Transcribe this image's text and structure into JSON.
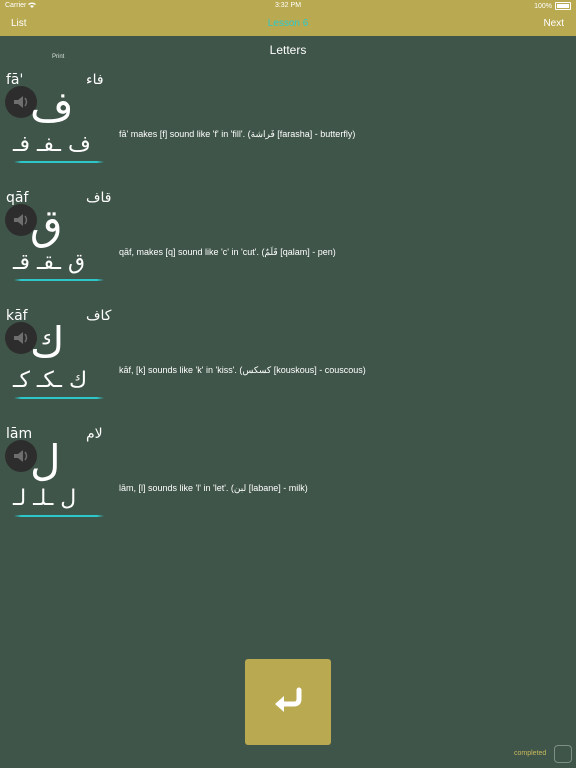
{
  "status_bar": {
    "carrier": "Carrier",
    "time": "3:32 PM",
    "battery": "100%"
  },
  "nav": {
    "left": "List",
    "title": "Lesson 6",
    "right": "Next"
  },
  "section_title": "Letters",
  "print_label": "Print",
  "letters": [
    {
      "latin_name": "fā'",
      "arabic_name": "فاء",
      "glyph": "ف",
      "forms": "ف ـفـ فـ",
      "description": "fā' makes [f] sound like 'f' in 'fill'. (فَراشة [farasha] - butterfly)"
    },
    {
      "latin_name": "qāf",
      "arabic_name": "قاف",
      "glyph": "ق",
      "forms": "ق ـقـ قـ",
      "description": "qāf, makes [q] sound like 'c' in 'cut'. (قَلَمٌ [qalam] - pen)"
    },
    {
      "latin_name": "kāf",
      "arabic_name": "كاف",
      "glyph": "ك",
      "forms": "ك ـكـ كـ",
      "description": "kāf, [k] sounds like 'k' in 'kiss'. (كسكس [kouskous] - couscous)"
    },
    {
      "latin_name": "lām",
      "arabic_name": "لام",
      "glyph": "ل",
      "forms": "ل ـلـ لـ",
      "description": "lām, [l] sounds like 'l' in 'let'. (لبن [labane] - milk)"
    }
  ],
  "completed_label": "completed",
  "colors": {
    "background": "#3f5549",
    "accent": "#b9a950",
    "highlight": "#2dc7c9"
  },
  "icons": {
    "speaker": "speaker-icon",
    "confirm": "return-arrow-icon"
  }
}
